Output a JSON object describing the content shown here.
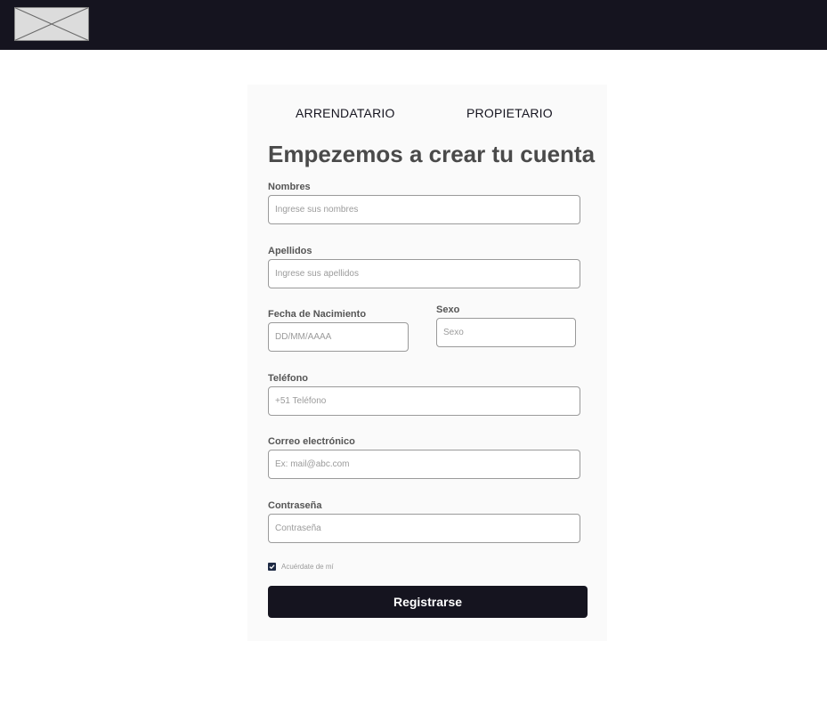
{
  "header": {
    "logo_icon": "image-placeholder-icon"
  },
  "tabs": [
    {
      "label": "ARRENDATARIO"
    },
    {
      "label": "PROPIETARIO"
    }
  ],
  "form": {
    "title": "Empezemos a crear tu cuenta",
    "fields": {
      "nombres": {
        "label": "Nombres",
        "placeholder": "Ingrese sus nombres"
      },
      "apellidos": {
        "label": "Apellidos",
        "placeholder": "Ingrese sus apellidos"
      },
      "fecha": {
        "label": "Fecha de Nacimiento",
        "placeholder": "DD/MM/AAAA"
      },
      "sexo": {
        "label": "Sexo",
        "placeholder": "Sexo"
      },
      "telefono": {
        "label": "Teléfono",
        "placeholder": "+51 Teléfono"
      },
      "correo": {
        "label": "Correo electrónico",
        "placeholder": "Ex: mail@abc.com"
      },
      "contrasena": {
        "label": "Contraseña",
        "placeholder": "Contraseña"
      }
    },
    "remember": {
      "label": "Acuérdate de mí",
      "checked": true
    },
    "submit_label": "Registrarse"
  },
  "colors": {
    "topbar": "#15141f",
    "button": "#15141f",
    "checkbox": "#1e2a44",
    "title": "#4a4a4a"
  }
}
